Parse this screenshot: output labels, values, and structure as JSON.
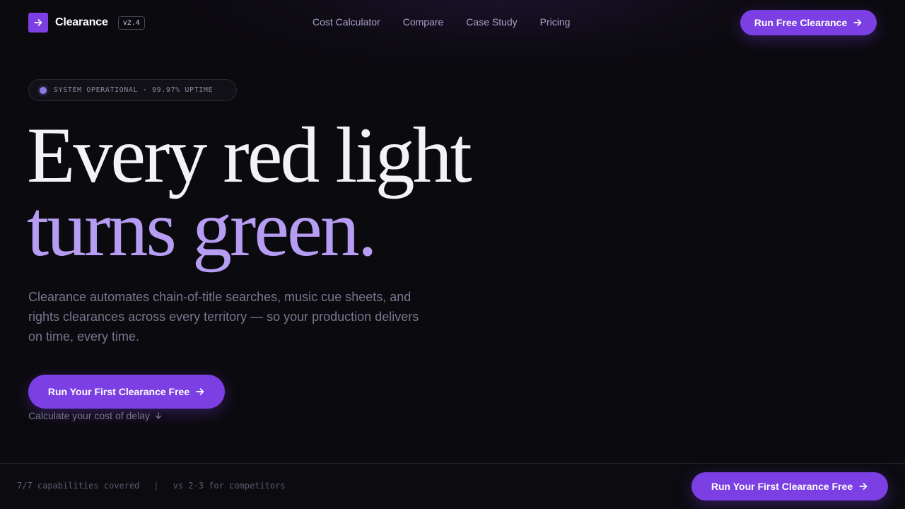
{
  "nav": {
    "brand": "Clearance",
    "version": "v2.4",
    "links": [
      "Cost Calculator",
      "Compare",
      "Case Study",
      "Pricing"
    ],
    "cta_label": "Run Free Clearance"
  },
  "hero": {
    "status": "SYSTEM OPERATIONAL · 99.97% UPTIME",
    "headline_line1": "Every red light",
    "headline_line2": "turns green.",
    "subcopy": "Clearance automates chain-of-title searches, music cue sheets, and rights clearances across every territory — so your production delivers on time, every time.",
    "cta_label": "Run Your First Clearance Free",
    "secondary_link": "Calculate your cost of delay"
  },
  "bottom_bar": {
    "stat_primary": "7/7 capabilities covered",
    "separator": "|",
    "stat_secondary": "vs 2-3 for competitors",
    "cta_label": "Run Your First Clearance Free"
  },
  "icons": {
    "logo": "arrow-right-icon",
    "cta": "arrow-right-icon",
    "secondary": "arrow-down-icon"
  },
  "colors": {
    "accent": "#7b3fe4",
    "headline_accent": "#b69cf2",
    "background": "#0b0a0e"
  }
}
